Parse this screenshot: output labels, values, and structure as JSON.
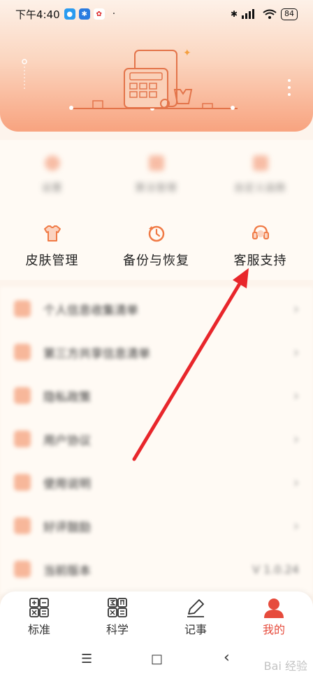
{
  "status_bar": {
    "time": "下午4:40",
    "battery": "84",
    "dot": "·"
  },
  "grid": {
    "row1": [
      {
        "label": "设置",
        "icon": "settings-icon"
      },
      {
        "label": "算法管理",
        "icon": "algorithm-icon"
      },
      {
        "label": "自定义函数",
        "icon": "function-icon"
      }
    ],
    "row2": [
      {
        "label": "皮肤管理",
        "icon": "shirt-icon"
      },
      {
        "label": "备份与恢复",
        "icon": "backup-icon"
      },
      {
        "label": "客服支持",
        "icon": "headset-icon"
      }
    ]
  },
  "list": {
    "items": [
      {
        "label": "个人信息收集清单"
      },
      {
        "label": "第三方共享信息清单"
      },
      {
        "label": "隐私政策"
      },
      {
        "label": "用户协议"
      },
      {
        "label": "使用说明"
      },
      {
        "label": "好评鼓励"
      },
      {
        "label": "当前版本",
        "value": "V 1.0.24"
      }
    ],
    "chevron": "›"
  },
  "bottom_nav": {
    "tabs": [
      {
        "label": "标准"
      },
      {
        "label": "科学"
      },
      {
        "label": "记事"
      },
      {
        "label": "我的"
      }
    ]
  },
  "system_nav": {
    "menu": "☰",
    "home": "□",
    "back": "‹"
  },
  "watermark": "Bai 经验",
  "colors": {
    "accent": "#e64b3c",
    "icon_orange": "#f07a45",
    "annotation_arrow": "#e8262b"
  }
}
